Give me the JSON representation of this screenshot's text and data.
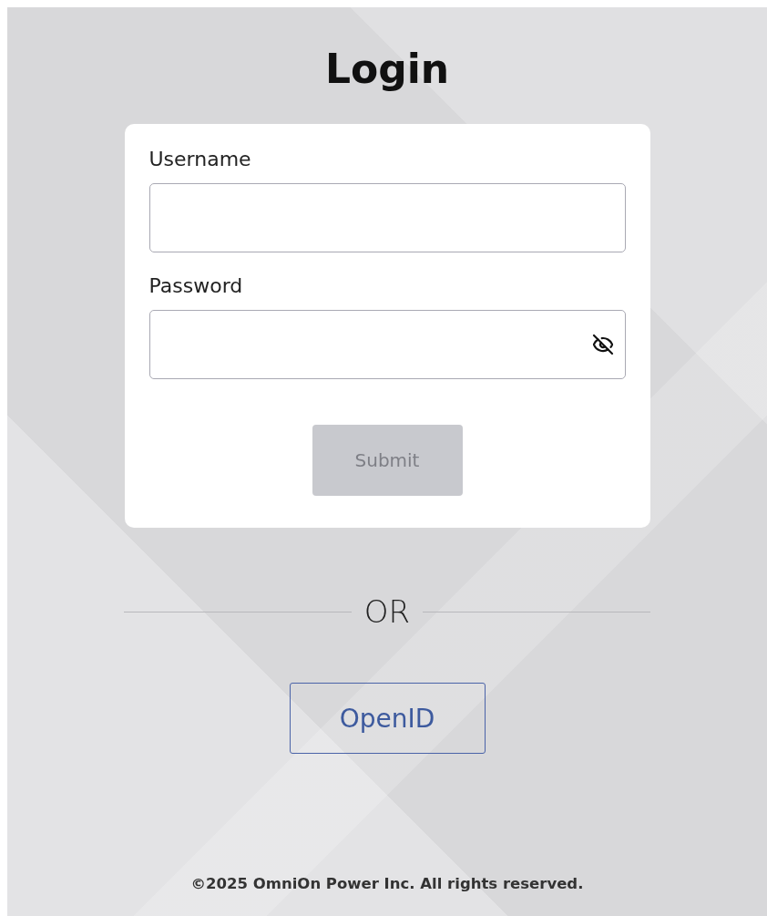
{
  "title": "Login",
  "fields": [
    {
      "label": "Username",
      "kind": "text"
    },
    {
      "label": "Password",
      "kind": "password",
      "password_visible": false
    }
  ],
  "submit": {
    "label": "Submit",
    "disabled": true
  },
  "divider_text": "OR",
  "openid_button": {
    "label": "OpenID"
  },
  "footer": "©2025 OmniOn Power Inc. All rights reserved."
}
